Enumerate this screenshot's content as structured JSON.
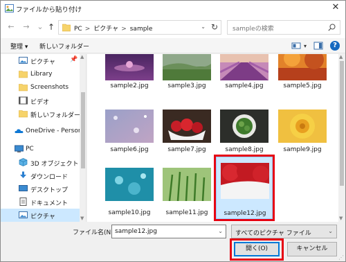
{
  "window": {
    "title": "ファイルから貼り付け",
    "close_glyph": "✕"
  },
  "nav": {
    "back": "←",
    "forward": "→",
    "recent": "⌄",
    "up": "↑"
  },
  "address": {
    "crumbs": [
      "PC",
      "ピクチャ",
      "sample"
    ],
    "separator": ">",
    "dropdown": "⌄",
    "refresh": "↻"
  },
  "search": {
    "placeholder": "sampleの検索"
  },
  "toolbar": {
    "organize": "整理 ▾",
    "new_folder": "新しいフォルダー",
    "view_dd": "▾"
  },
  "sidebar": {
    "items": [
      {
        "label": "ピクチャ",
        "icon": "pictures-icon",
        "pinned": true
      },
      {
        "label": "Library",
        "icon": "folder-icon"
      },
      {
        "label": "Screenshots",
        "icon": "folder-icon"
      },
      {
        "label": "ビデオ",
        "icon": "videos-icon"
      },
      {
        "label": "新しいフォルダー",
        "icon": "folder-icon"
      },
      {
        "label": "OneDrive - Persor",
        "icon": "onedrive-icon"
      },
      {
        "label": "PC",
        "icon": "pc-icon"
      },
      {
        "label": "3D オブジェクト",
        "icon": "3d-objects-icon"
      },
      {
        "label": "ダウンロード",
        "icon": "downloads-icon"
      },
      {
        "label": "デスクトップ",
        "icon": "desktop-icon"
      },
      {
        "label": "ドキュメント",
        "icon": "documents-icon"
      },
      {
        "label": "ピクチャ",
        "icon": "pictures-icon"
      }
    ]
  },
  "files": [
    "sample2.jpg",
    "sample3.jpg",
    "sample4.jpg",
    "sample5.jpg",
    "sample6.jpg",
    "sample7.jpg",
    "sample8.jpg",
    "sample9.jpg",
    "sample10.jpg",
    "sample11.jpg",
    "sample12.jpg"
  ],
  "selected_file": "sample12.jpg",
  "bottom": {
    "filename_label": "ファイル名(N):",
    "filename_value": "sample12.jpg",
    "filetype_value": "すべてのピクチャ ファイル",
    "open_label": "開く(O)",
    "cancel_label": "キャンセル"
  },
  "colors": {
    "selection": "#cce8ff",
    "highlight_box": "#e60012",
    "accent": "#0078d7"
  }
}
